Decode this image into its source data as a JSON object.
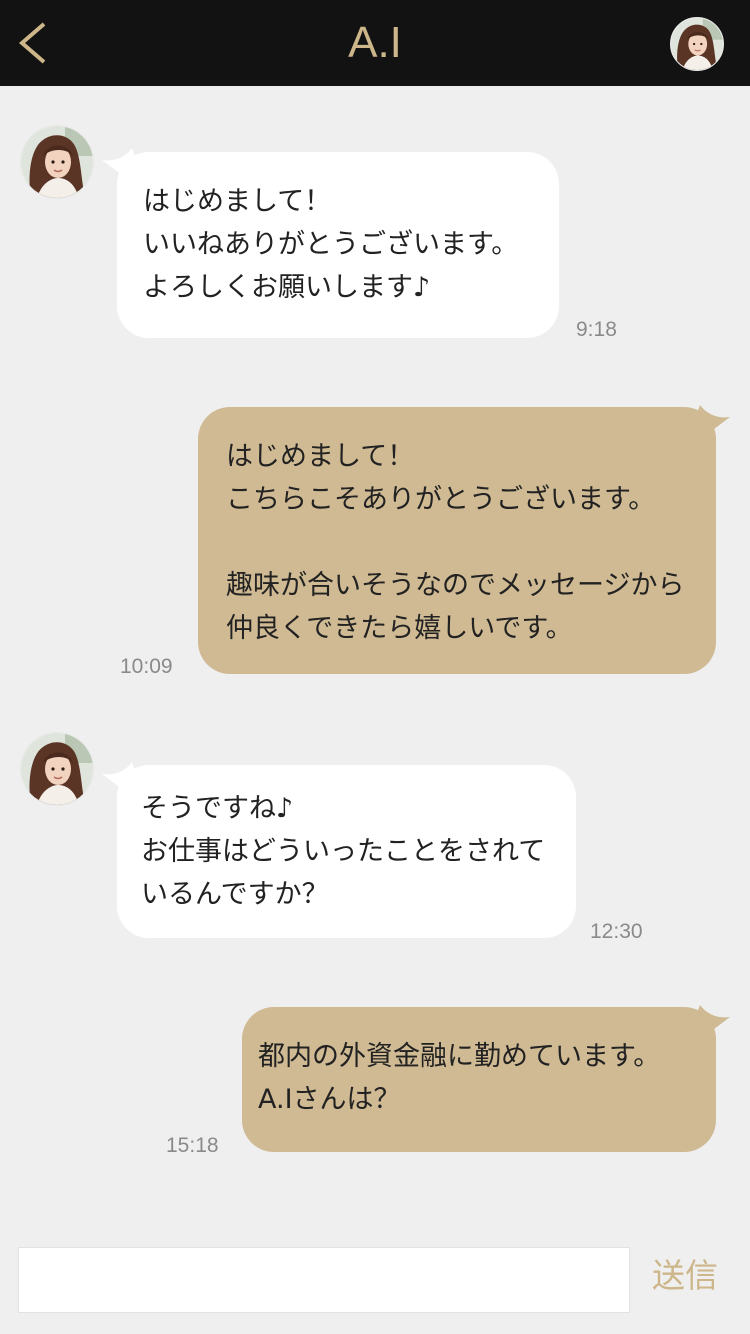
{
  "header": {
    "title": "A.I",
    "back_icon": "chevron-left-icon",
    "avatar_icon": "profile-avatar"
  },
  "colors": {
    "header_bg": "#121212",
    "accent": "#cdb68a",
    "background": "#efefef",
    "incoming_bubble": "#ffffff",
    "outgoing_bubble": "#cfba93",
    "time_text": "#8a8a8a"
  },
  "messages": [
    {
      "direction": "incoming",
      "text": "はじめまして！\nいいねありがとうございます。\nよろしくお願いします♪",
      "time": "9:18"
    },
    {
      "direction": "outgoing",
      "text": "はじめまして！\nこちらこそありがとうございます。\n\n趣味が合いそうなのでメッセージから仲良くできたら嬉しいです。",
      "time": "10:09"
    },
    {
      "direction": "incoming",
      "text": "そうですね♪\nお仕事はどういったことをされているんですか？",
      "time": "12:30"
    },
    {
      "direction": "outgoing",
      "text": "都内の外資金融に勤めています。\nA.Iさんは？",
      "time": "15:18"
    }
  ],
  "composer": {
    "value": "",
    "send_label": "送信"
  }
}
